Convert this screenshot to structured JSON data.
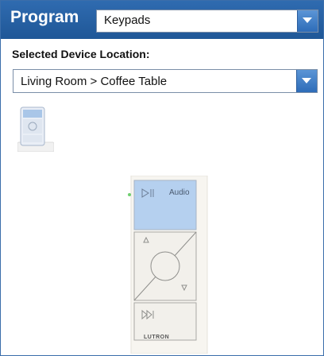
{
  "header": {
    "title": "Program",
    "program_dropdown": {
      "selected": "Keypads",
      "icon": "chevron-down-icon"
    }
  },
  "location": {
    "label": "Selected Device Location:",
    "dropdown": {
      "selected": "Living Room > Coffee Table",
      "icon": "chevron-down-icon"
    }
  },
  "device_list": [
    {
      "icon": "keypad-thumbnail-icon",
      "selected": true
    }
  ],
  "keypad": {
    "buttons": [
      {
        "label": "Audio",
        "icon": "play-pause-icon",
        "active": true
      },
      {
        "label": "",
        "icon": "raise-lower-dial-icon",
        "active": false
      },
      {
        "label": "",
        "icon": "next-track-icon",
        "active": false
      }
    ],
    "brand": "LUTRON",
    "led_on": true
  },
  "colors": {
    "header": "#2563a6",
    "accent": "#2d6cb8",
    "active_button": "#b5d0ef",
    "led": "#6fcf6f"
  }
}
